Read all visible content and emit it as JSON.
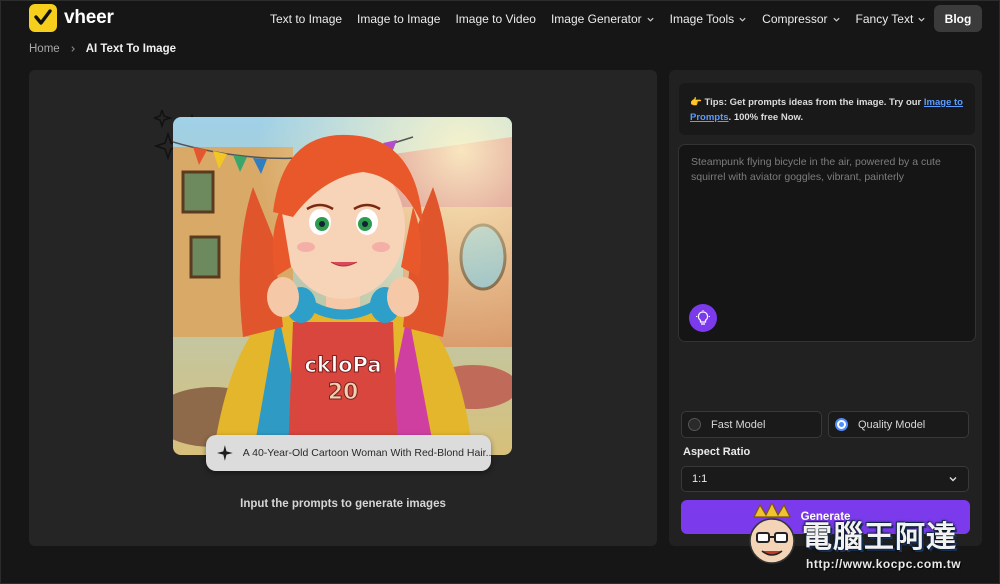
{
  "brand": {
    "name": "vheer",
    "logo_color": "#f6cf1d"
  },
  "nav": {
    "items": [
      {
        "label": "Text to Image",
        "dropdown": false
      },
      {
        "label": "Image to Image",
        "dropdown": false
      },
      {
        "label": "Image to Video",
        "dropdown": false
      },
      {
        "label": "Image Generator",
        "dropdown": true
      },
      {
        "label": "Image Tools",
        "dropdown": true
      },
      {
        "label": "Compressor",
        "dropdown": true
      },
      {
        "label": "Fancy Text",
        "dropdown": true
      }
    ],
    "blog_label": "Blog"
  },
  "breadcrumb": {
    "home": "Home",
    "current": "AI Text To Image"
  },
  "preview": {
    "prompt_chip": "A 40-Year-Old Cartoon Woman With Red-Blond Hair...",
    "shirt_text": "ckloPa",
    "shirt_number": "20",
    "hint": "Input the prompts to generate images"
  },
  "sidebar": {
    "tips": {
      "prefix": "👉 Tips: Get prompts ideas from the image. Try our ",
      "link": "Image to Prompts",
      "suffix": ". 100% free Now."
    },
    "prompt_placeholder": "Steampunk flying bicycle in the air, powered by a cute squirrel with aviator goggles, vibrant, painterly",
    "models": [
      {
        "label": "Fast Model",
        "selected": false
      },
      {
        "label": "Quality Model",
        "selected": true
      }
    ],
    "aspect_ratio_label": "Aspect Ratio",
    "aspect_ratio_value": "1:1",
    "generate_label": "Generate"
  },
  "watermark": {
    "title": "電腦王阿達",
    "url": "http://www.kocpc.com.tw"
  },
  "colors": {
    "accent": "#7c3aed",
    "link": "#5c9cff",
    "radio_selected": "#4f8cff",
    "background": "#161616"
  }
}
